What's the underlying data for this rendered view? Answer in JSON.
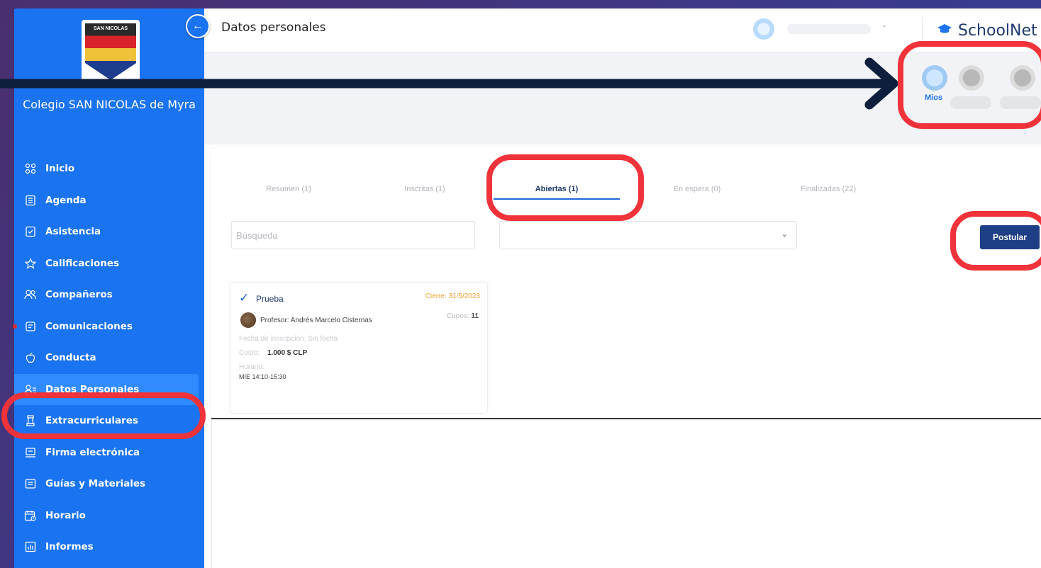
{
  "school": {
    "name": "Colegio SAN NICOLAS de Myra",
    "logo_text": "SAN NICOLAS"
  },
  "sidebar": {
    "items": [
      {
        "label": "Inicio",
        "icon": "grid-icon"
      },
      {
        "label": "Agenda",
        "icon": "agenda-icon"
      },
      {
        "label": "Asistencia",
        "icon": "attendance-icon"
      },
      {
        "label": "Calificaciones",
        "icon": "star-icon"
      },
      {
        "label": "Compañeros",
        "icon": "people-icon"
      },
      {
        "label": "Comunicaciones",
        "icon": "message-icon"
      },
      {
        "label": "Conducta",
        "icon": "apple-icon"
      },
      {
        "label": "Datos Personales",
        "icon": "person-list-icon"
      },
      {
        "label": "Extracurriculares",
        "icon": "chess-icon"
      },
      {
        "label": "Firma electrónica",
        "icon": "signature-icon"
      },
      {
        "label": "Guías y Materiales",
        "icon": "folder-icon"
      },
      {
        "label": "Horario",
        "icon": "calendar-clock-icon"
      },
      {
        "label": "Informes",
        "icon": "report-icon"
      }
    ]
  },
  "header": {
    "title": "Datos personales",
    "brand": "SchoolNet"
  },
  "children": {
    "selected_label": "Mios"
  },
  "tabs": [
    {
      "label": "Resumen (1)"
    },
    {
      "label": "Inscritas (1)"
    },
    {
      "label": "Abiertas (1)"
    },
    {
      "label": "En espera (0)"
    },
    {
      "label": "Finalizadas (22)"
    }
  ],
  "search": {
    "placeholder": "Búsqueda"
  },
  "actions": {
    "postular": "Postular"
  },
  "card": {
    "title": "Prueba",
    "deadline": "Cierre: 31/5/2023",
    "teacher": "Profesor: Andrés Marcelo Cisternas",
    "cupos_label": "Cupos:",
    "cupos_value": "11",
    "inscripcion": "Fecha de inscripción: Sin fecha",
    "costo_label": "Costo:",
    "costo_value": "1.000 $ CLP",
    "horario_label": "Horario:",
    "horario_value": "MIE 14:10-15:30"
  },
  "colors": {
    "sidebar": "#1a73f0",
    "highlight": "#f0333a",
    "primary_button": "#1e3f85",
    "deadline": "#f0a030"
  }
}
